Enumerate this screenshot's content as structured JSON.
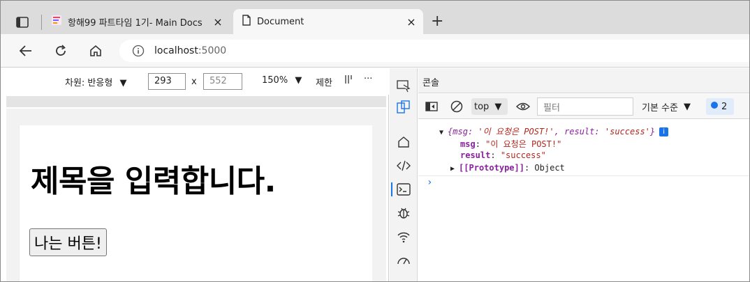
{
  "browser": {
    "tabs": [
      {
        "label": "항해99 파트타임 1기- Main Docs",
        "close": "×",
        "active": false
      },
      {
        "label": "Document",
        "close": "×",
        "active": true
      }
    ],
    "new_tab": "+",
    "address": {
      "host": "localhost",
      "port": ":5000"
    }
  },
  "device_toolbar": {
    "dimensions_label": "차원: 반응형",
    "width": "293",
    "times": "x",
    "height_placeholder": "552",
    "zoom": "150%",
    "throttle": "제한",
    "more": "···"
  },
  "page": {
    "heading": "제목을 입력합니다.",
    "button_label": "나는 버튼!"
  },
  "devtools": {
    "panel_title": "콘솔",
    "context": "top",
    "filter_placeholder": "필터",
    "level": "기본 수준",
    "issues_count": "2",
    "console": {
      "summary_open": "{",
      "summary_msg_key": "msg:",
      "summary_msg_val": " '이 요청은 POST!'",
      "summary_comma": ", ",
      "summary_result_key": "result:",
      "summary_result_val": " 'success'",
      "summary_close": "}",
      "info_badge": "i",
      "msg_key": "msg",
      "msg_value": "\"이 요청은 POST!\"",
      "result_key": "result",
      "result_value": "\"success\"",
      "proto_key": "[[Prototype]]",
      "proto_value": "Object",
      "prompt": "›"
    }
  },
  "colors": {
    "accent": "#1a73e8",
    "key": "#8a1fa0",
    "string": "#b3261e"
  }
}
